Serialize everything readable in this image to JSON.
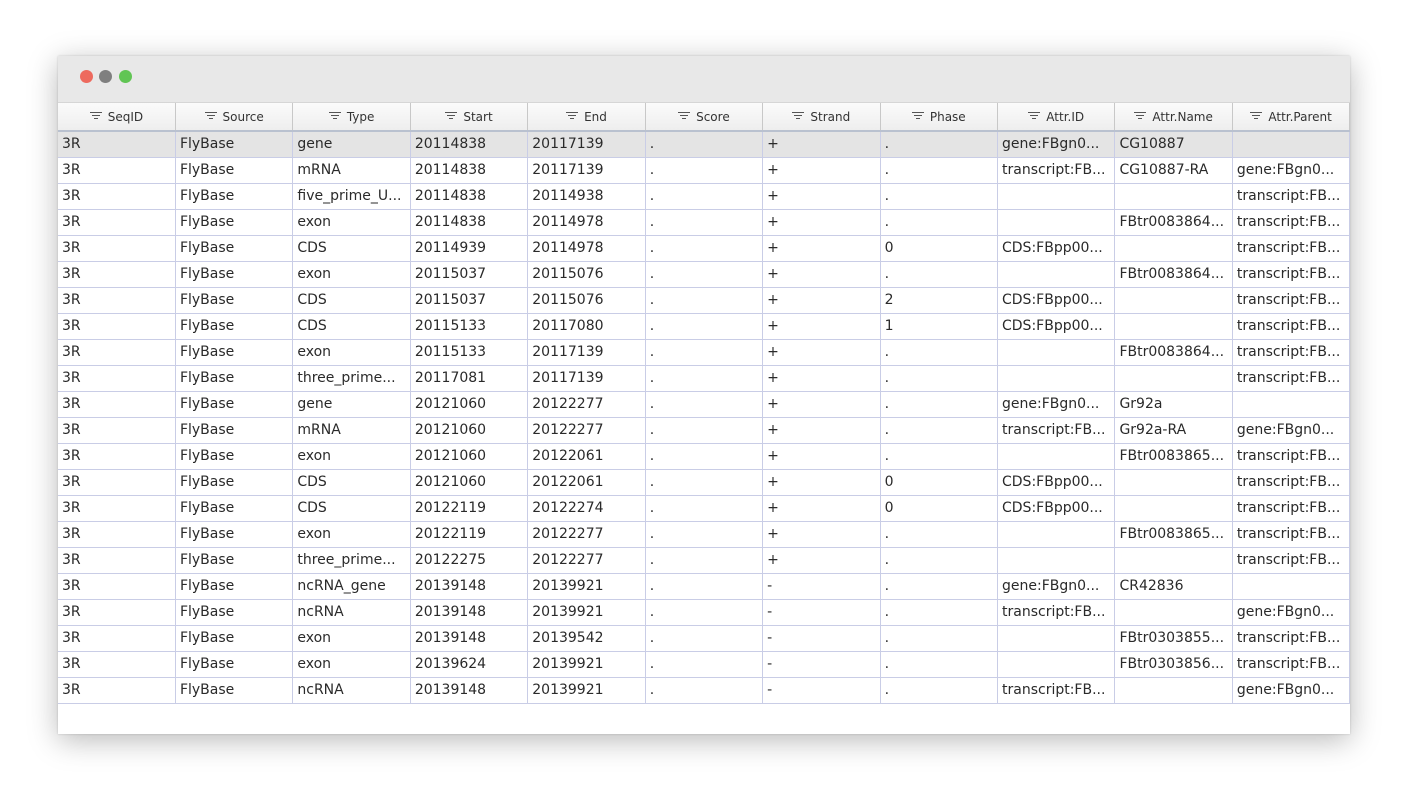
{
  "window": {
    "controls": [
      "close-icon",
      "minimize-icon",
      "maximize-icon"
    ],
    "colors": {
      "close": "#ed6a5e",
      "minimize": "#7f7f7f",
      "maximize": "#61c554"
    }
  },
  "table": {
    "filter_icon": "filter-icon",
    "columns": [
      "SeqID",
      "Source",
      "Type",
      "Start",
      "End",
      "Score",
      "Strand",
      "Phase",
      "Attr.ID",
      "Attr.Name",
      "Attr.Parent"
    ],
    "selected_row": 0,
    "rows": [
      [
        "3R",
        "FlyBase",
        "gene",
        "20114838",
        "20117139",
        ".",
        "+",
        ".",
        "gene:FBgn0...",
        "CG10887",
        ""
      ],
      [
        "3R",
        "FlyBase",
        "mRNA",
        "20114838",
        "20117139",
        ".",
        "+",
        ".",
        "transcript:FB...",
        "CG10887-RA",
        "gene:FBgn0..."
      ],
      [
        "3R",
        "FlyBase",
        "five_prime_U...",
        "20114838",
        "20114938",
        ".",
        "+",
        ".",
        "",
        "",
        "transcript:FB..."
      ],
      [
        "3R",
        "FlyBase",
        "exon",
        "20114838",
        "20114978",
        ".",
        "+",
        ".",
        "",
        "FBtr0083864...",
        "transcript:FB..."
      ],
      [
        "3R",
        "FlyBase",
        "CDS",
        "20114939",
        "20114978",
        ".",
        "+",
        "0",
        "CDS:FBpp00...",
        "",
        "transcript:FB..."
      ],
      [
        "3R",
        "FlyBase",
        "exon",
        "20115037",
        "20115076",
        ".",
        "+",
        ".",
        "",
        "FBtr0083864...",
        "transcript:FB..."
      ],
      [
        "3R",
        "FlyBase",
        "CDS",
        "20115037",
        "20115076",
        ".",
        "+",
        "2",
        "CDS:FBpp00...",
        "",
        "transcript:FB..."
      ],
      [
        "3R",
        "FlyBase",
        "CDS",
        "20115133",
        "20117080",
        ".",
        "+",
        "1",
        "CDS:FBpp00...",
        "",
        "transcript:FB..."
      ],
      [
        "3R",
        "FlyBase",
        "exon",
        "20115133",
        "20117139",
        ".",
        "+",
        ".",
        "",
        "FBtr0083864...",
        "transcript:FB..."
      ],
      [
        "3R",
        "FlyBase",
        "three_prime...",
        "20117081",
        "20117139",
        ".",
        "+",
        ".",
        "",
        "",
        "transcript:FB..."
      ],
      [
        "3R",
        "FlyBase",
        "gene",
        "20121060",
        "20122277",
        ".",
        "+",
        ".",
        "gene:FBgn0...",
        "Gr92a",
        ""
      ],
      [
        "3R",
        "FlyBase",
        "mRNA",
        "20121060",
        "20122277",
        ".",
        "+",
        ".",
        "transcript:FB...",
        "Gr92a-RA",
        "gene:FBgn0..."
      ],
      [
        "3R",
        "FlyBase",
        "exon",
        "20121060",
        "20122061",
        ".",
        "+",
        ".",
        "",
        "FBtr0083865...",
        "transcript:FB..."
      ],
      [
        "3R",
        "FlyBase",
        "CDS",
        "20121060",
        "20122061",
        ".",
        "+",
        "0",
        "CDS:FBpp00...",
        "",
        "transcript:FB..."
      ],
      [
        "3R",
        "FlyBase",
        "CDS",
        "20122119",
        "20122274",
        ".",
        "+",
        "0",
        "CDS:FBpp00...",
        "",
        "transcript:FB..."
      ],
      [
        "3R",
        "FlyBase",
        "exon",
        "20122119",
        "20122277",
        ".",
        "+",
        ".",
        "",
        "FBtr0083865...",
        "transcript:FB..."
      ],
      [
        "3R",
        "FlyBase",
        "three_prime...",
        "20122275",
        "20122277",
        ".",
        "+",
        ".",
        "",
        "",
        "transcript:FB..."
      ],
      [
        "3R",
        "FlyBase",
        "ncRNA_gene",
        "20139148",
        "20139921",
        ".",
        "-",
        ".",
        "gene:FBgn0...",
        "CR42836",
        ""
      ],
      [
        "3R",
        "FlyBase",
        "ncRNA",
        "20139148",
        "20139921",
        ".",
        "-",
        ".",
        "transcript:FB...",
        "",
        "gene:FBgn0..."
      ],
      [
        "3R",
        "FlyBase",
        "exon",
        "20139148",
        "20139542",
        ".",
        "-",
        ".",
        "",
        "FBtr0303855...",
        "transcript:FB..."
      ],
      [
        "3R",
        "FlyBase",
        "exon",
        "20139624",
        "20139921",
        ".",
        "-",
        ".",
        "",
        "FBtr0303856...",
        "transcript:FB..."
      ],
      [
        "3R",
        "FlyBase",
        "ncRNA",
        "20139148",
        "20139921",
        ".",
        "-",
        ".",
        "transcript:FB...",
        "",
        "gene:FBgn0..."
      ]
    ]
  }
}
